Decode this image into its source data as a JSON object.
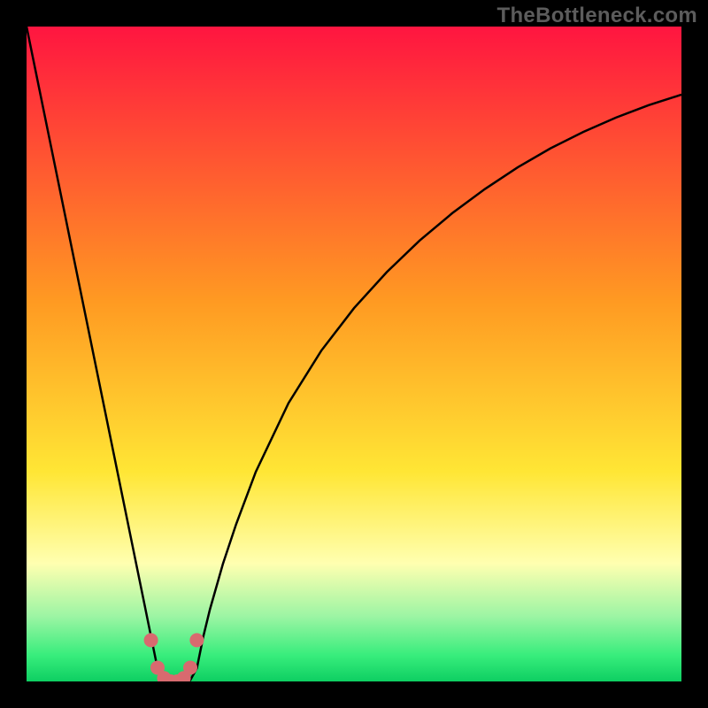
{
  "watermark": "TheBottleneck.com",
  "colors": {
    "top_red": "#ff1540",
    "orange": "#ff9a22",
    "yellow": "#ffe635",
    "pale_yellow": "#ffffb0",
    "green_light": "#38ed7c",
    "green_base": "#0ecf62",
    "black": "#000000",
    "curve": "#000000",
    "dots": "#d86a6f"
  },
  "chart_data": {
    "type": "line",
    "title": "",
    "xlabel": "",
    "ylabel": "",
    "xlim": [
      0,
      100
    ],
    "ylim": [
      0,
      100
    ],
    "x": [
      0,
      2,
      4,
      6,
      8,
      10,
      12,
      14,
      16,
      18,
      19,
      20,
      21,
      22,
      23,
      24,
      25,
      26,
      27,
      28,
      30,
      32,
      35,
      40,
      45,
      50,
      55,
      60,
      65,
      70,
      75,
      80,
      85,
      90,
      95,
      100
    ],
    "values": [
      100,
      90.2,
      80.4,
      70.6,
      60.8,
      51.0,
      41.2,
      31.4,
      21.6,
      11.8,
      6.9,
      2.0,
      0.2,
      0.0,
      0.0,
      0.0,
      0.2,
      2.0,
      6.9,
      11.0,
      18.0,
      24.0,
      32.0,
      42.5,
      50.5,
      57.0,
      62.5,
      67.3,
      71.5,
      75.2,
      78.5,
      81.4,
      83.9,
      86.1,
      88.0,
      89.6
    ],
    "minimum_at_x": 22.5,
    "dots": [
      {
        "x": 19.0,
        "y": 6.3
      },
      {
        "x": 20.0,
        "y": 2.1
      },
      {
        "x": 21.0,
        "y": 0.5
      },
      {
        "x": 22.0,
        "y": 0.0
      },
      {
        "x": 23.0,
        "y": 0.0
      },
      {
        "x": 24.0,
        "y": 0.5
      },
      {
        "x": 25.0,
        "y": 2.1
      },
      {
        "x": 26.0,
        "y": 6.3
      }
    ],
    "gradient_stops": [
      {
        "offset": 0.0,
        "color": "#ff1540"
      },
      {
        "offset": 0.42,
        "color": "#ff9a22"
      },
      {
        "offset": 0.68,
        "color": "#ffe635"
      },
      {
        "offset": 0.82,
        "color": "#ffffb0"
      },
      {
        "offset": 0.9,
        "color": "#9df5a4"
      },
      {
        "offset": 0.96,
        "color": "#38ed7c"
      },
      {
        "offset": 1.0,
        "color": "#0ecf62"
      }
    ]
  }
}
